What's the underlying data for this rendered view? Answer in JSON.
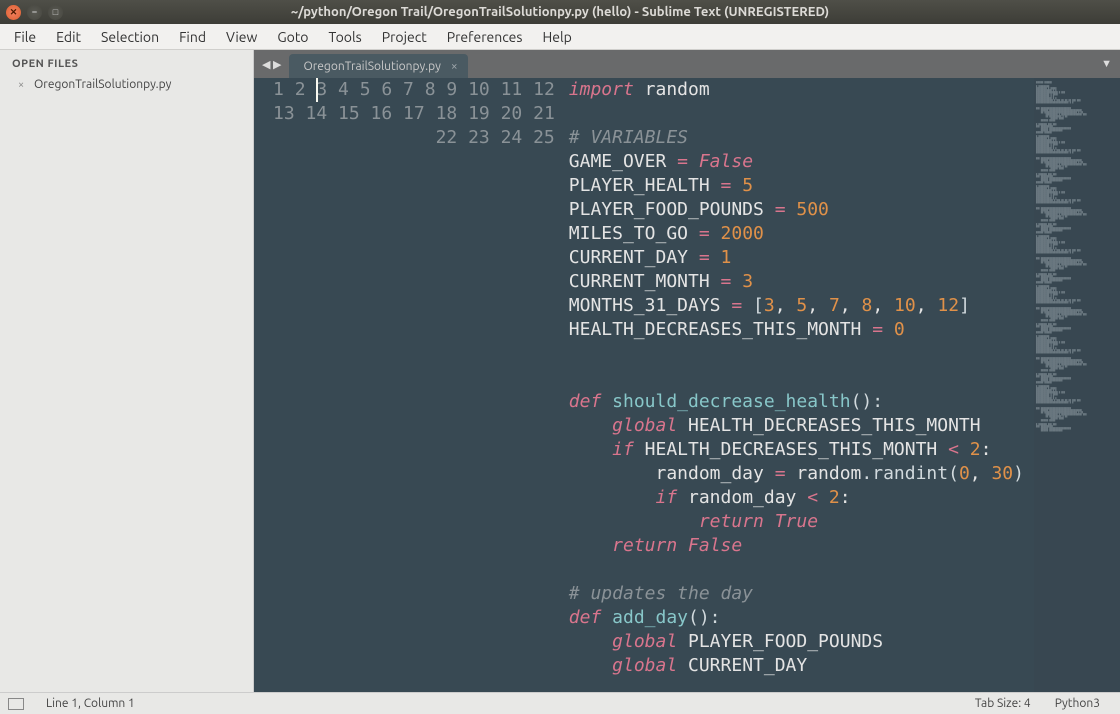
{
  "window": {
    "title": "~/python/Oregon Trail/OregonTrailSolutionpy.py (hello) - Sublime Text (UNREGISTERED)"
  },
  "menu": {
    "items": [
      "File",
      "Edit",
      "Selection",
      "Find",
      "View",
      "Goto",
      "Tools",
      "Project",
      "Preferences",
      "Help"
    ]
  },
  "sidebar": {
    "header": "OPEN FILES",
    "files": [
      {
        "name": "OregonTrailSolutionpy.py"
      }
    ]
  },
  "tabs": {
    "active": {
      "label": "OregonTrailSolutionpy.py"
    }
  },
  "statusbar": {
    "position": "Line 1, Column 1",
    "tabsize": "Tab Size: 4",
    "syntax": "Python3"
  },
  "code": {
    "lines": [
      [
        {
          "t": "kw",
          "s": "import"
        },
        {
          "t": "name",
          "s": " random"
        }
      ],
      [],
      [
        {
          "t": "comment",
          "s": "# VARIABLES"
        }
      ],
      [
        {
          "t": "name",
          "s": "GAME_OVER "
        },
        {
          "t": "op",
          "s": "="
        },
        {
          "t": "name",
          "s": " "
        },
        {
          "t": "const",
          "s": "False"
        }
      ],
      [
        {
          "t": "name",
          "s": "PLAYER_HEALTH "
        },
        {
          "t": "op",
          "s": "="
        },
        {
          "t": "name",
          "s": " "
        },
        {
          "t": "num",
          "s": "5"
        }
      ],
      [
        {
          "t": "name",
          "s": "PLAYER_FOOD_POUNDS "
        },
        {
          "t": "op",
          "s": "="
        },
        {
          "t": "name",
          "s": " "
        },
        {
          "t": "num",
          "s": "500"
        }
      ],
      [
        {
          "t": "name",
          "s": "MILES_TO_GO "
        },
        {
          "t": "op",
          "s": "="
        },
        {
          "t": "name",
          "s": " "
        },
        {
          "t": "num",
          "s": "2000"
        }
      ],
      [
        {
          "t": "name",
          "s": "CURRENT_DAY "
        },
        {
          "t": "op",
          "s": "="
        },
        {
          "t": "name",
          "s": " "
        },
        {
          "t": "num",
          "s": "1"
        }
      ],
      [
        {
          "t": "name",
          "s": "CURRENT_MONTH "
        },
        {
          "t": "op",
          "s": "="
        },
        {
          "t": "name",
          "s": " "
        },
        {
          "t": "num",
          "s": "3"
        }
      ],
      [
        {
          "t": "name",
          "s": "MONTHS_31_DAYS "
        },
        {
          "t": "op",
          "s": "="
        },
        {
          "t": "name",
          "s": " "
        },
        {
          "t": "bracket",
          "s": "["
        },
        {
          "t": "num",
          "s": "3"
        },
        {
          "t": "name",
          "s": ", "
        },
        {
          "t": "num",
          "s": "5"
        },
        {
          "t": "name",
          "s": ", "
        },
        {
          "t": "num",
          "s": "7"
        },
        {
          "t": "name",
          "s": ", "
        },
        {
          "t": "num",
          "s": "8"
        },
        {
          "t": "name",
          "s": ", "
        },
        {
          "t": "num",
          "s": "10"
        },
        {
          "t": "name",
          "s": ", "
        },
        {
          "t": "num",
          "s": "12"
        },
        {
          "t": "bracket",
          "s": "]"
        }
      ],
      [
        {
          "t": "name",
          "s": "HEALTH_DECREASES_THIS_MONTH "
        },
        {
          "t": "op",
          "s": "="
        },
        {
          "t": "name",
          "s": " "
        },
        {
          "t": "num",
          "s": "0"
        }
      ],
      [],
      [],
      [
        {
          "t": "kw",
          "s": "def"
        },
        {
          "t": "name",
          "s": " "
        },
        {
          "t": "func",
          "s": "should_decrease_health"
        },
        {
          "t": "paren",
          "s": "():"
        }
      ],
      [
        {
          "t": "name",
          "s": "    "
        },
        {
          "t": "kw",
          "s": "global"
        },
        {
          "t": "name",
          "s": " HEALTH_DECREASES_THIS_MONTH"
        }
      ],
      [
        {
          "t": "name",
          "s": "    "
        },
        {
          "t": "kw",
          "s": "if"
        },
        {
          "t": "name",
          "s": " HEALTH_DECREASES_THIS_MONTH "
        },
        {
          "t": "op",
          "s": "<"
        },
        {
          "t": "name",
          "s": " "
        },
        {
          "t": "num",
          "s": "2"
        },
        {
          "t": "name",
          "s": ":"
        }
      ],
      [
        {
          "t": "name",
          "s": "        random_day "
        },
        {
          "t": "op",
          "s": "="
        },
        {
          "t": "name",
          "s": " random"
        },
        {
          "t": "dot",
          "s": "."
        },
        {
          "t": "call",
          "s": "randint"
        },
        {
          "t": "paren",
          "s": "("
        },
        {
          "t": "num",
          "s": "0"
        },
        {
          "t": "name",
          "s": ", "
        },
        {
          "t": "num",
          "s": "30"
        },
        {
          "t": "paren",
          "s": ")"
        }
      ],
      [
        {
          "t": "name",
          "s": "        "
        },
        {
          "t": "kw",
          "s": "if"
        },
        {
          "t": "name",
          "s": " random_day "
        },
        {
          "t": "op",
          "s": "<"
        },
        {
          "t": "name",
          "s": " "
        },
        {
          "t": "num",
          "s": "2"
        },
        {
          "t": "name",
          "s": ":"
        }
      ],
      [
        {
          "t": "name",
          "s": "            "
        },
        {
          "t": "kw",
          "s": "return"
        },
        {
          "t": "name",
          "s": " "
        },
        {
          "t": "const",
          "s": "True"
        }
      ],
      [
        {
          "t": "name",
          "s": "    "
        },
        {
          "t": "kw",
          "s": "return"
        },
        {
          "t": "name",
          "s": " "
        },
        {
          "t": "const",
          "s": "False"
        }
      ],
      [],
      [
        {
          "t": "comment",
          "s": "# updates the day"
        }
      ],
      [
        {
          "t": "kw",
          "s": "def"
        },
        {
          "t": "name",
          "s": " "
        },
        {
          "t": "func",
          "s": "add_day"
        },
        {
          "t": "paren",
          "s": "():"
        }
      ],
      [
        {
          "t": "name",
          "s": "    "
        },
        {
          "t": "kw",
          "s": "global"
        },
        {
          "t": "name",
          "s": " PLAYER_FOOD_POUNDS"
        }
      ],
      [
        {
          "t": "name",
          "s": "    "
        },
        {
          "t": "kw",
          "s": "global"
        },
        {
          "t": "name",
          "s": " CURRENT_DAY"
        }
      ]
    ]
  }
}
